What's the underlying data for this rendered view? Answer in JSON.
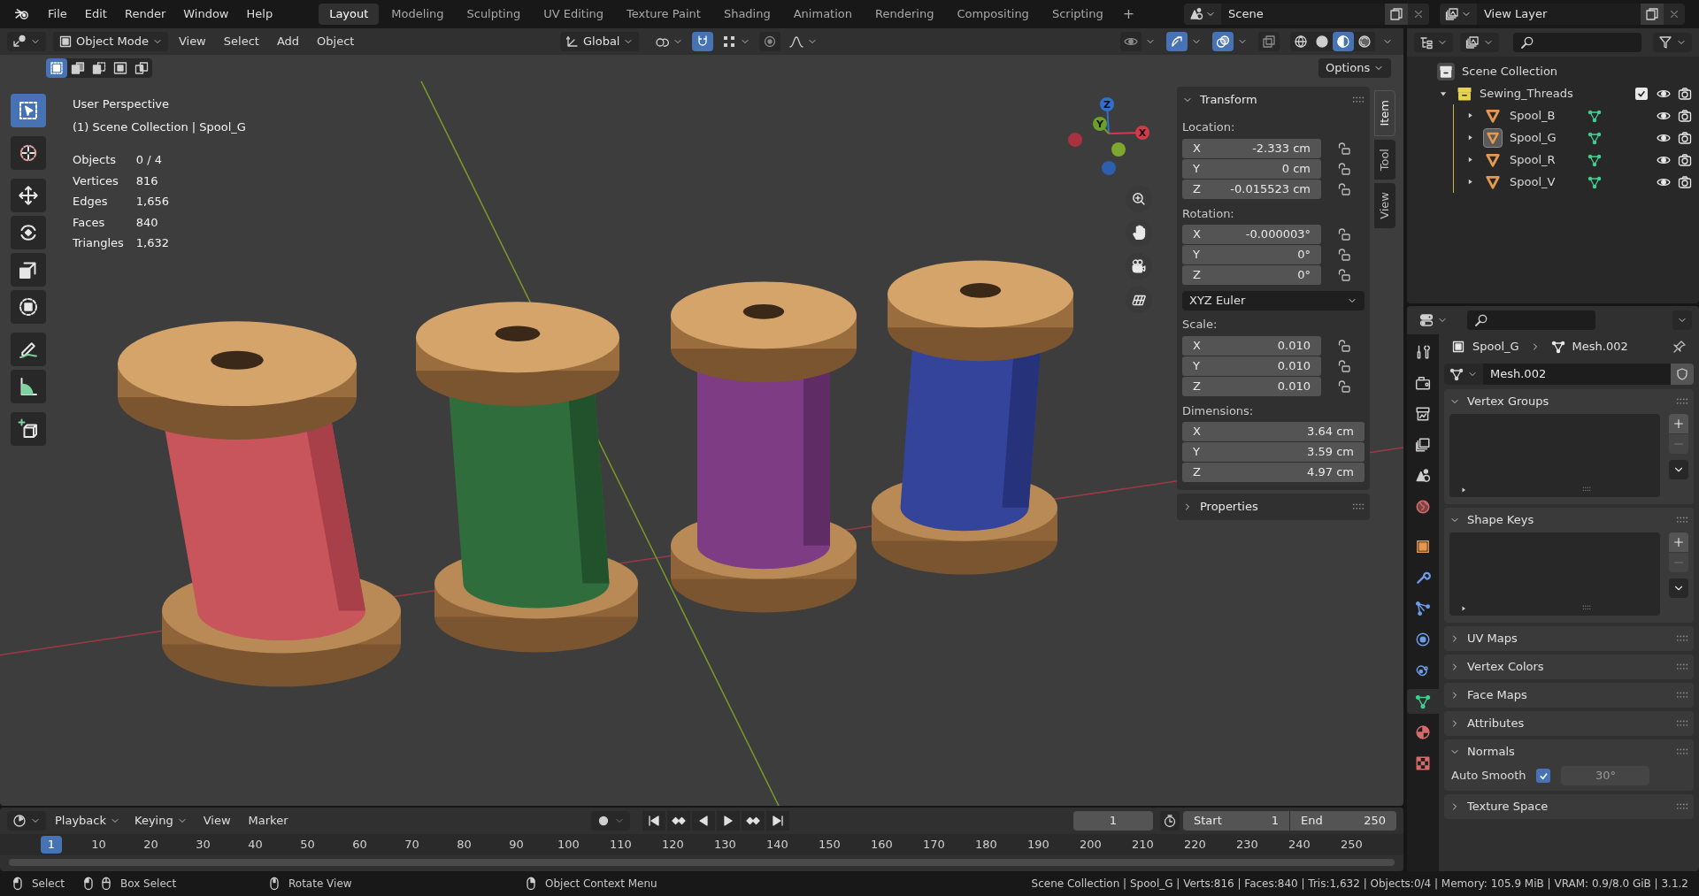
{
  "menu": [
    "File",
    "Edit",
    "Render",
    "Window",
    "Help"
  ],
  "workspaces": [
    {
      "label": "Layout",
      "selected": true
    },
    {
      "label": "Modeling",
      "selected": false
    },
    {
      "label": "Sculpting",
      "selected": false
    },
    {
      "label": "UV Editing",
      "selected": false
    },
    {
      "label": "Texture Paint",
      "selected": false
    },
    {
      "label": "Shading",
      "selected": false
    },
    {
      "label": "Animation",
      "selected": false
    },
    {
      "label": "Rendering",
      "selected": false
    },
    {
      "label": "Compositing",
      "selected": false
    },
    {
      "label": "Scripting",
      "selected": false
    }
  ],
  "add_workspace": "+",
  "scene": "Scene",
  "view_layer": "View Layer",
  "viewport": {
    "mode": "Object Mode",
    "menus": [
      "View",
      "Select",
      "Add",
      "Object"
    ],
    "orientation": "Global",
    "toggles": [
      {
        "kind": "snap",
        "on": true
      },
      {
        "kind": "proportional",
        "on": false
      },
      {
        "kind": "visibility",
        "on": false
      },
      {
        "kind": "gizmos",
        "on": true
      },
      {
        "kind": "overlays",
        "on": true
      },
      {
        "kind": "xray",
        "on": false
      }
    ],
    "shading": [
      {
        "kind": "wireframe",
        "selected": false
      },
      {
        "kind": "solid",
        "selected": false
      },
      {
        "kind": "material",
        "selected": true
      },
      {
        "kind": "rendered",
        "selected": false
      }
    ],
    "select_modes": [
      {
        "selected": true
      },
      {
        "selected": false
      },
      {
        "selected": false
      },
      {
        "selected": false
      },
      {
        "selected": false
      }
    ],
    "options": "Options",
    "tools": [
      {
        "kind": "select",
        "selected": true
      },
      {
        "kind": "cursor",
        "selected": false
      },
      {
        "kind": "move",
        "selected": false
      },
      {
        "kind": "rotate",
        "selected": false
      },
      {
        "kind": "scale",
        "selected": false
      },
      {
        "kind": "transform",
        "selected": false
      },
      {
        "kind": "annotate",
        "selected": false
      },
      {
        "kind": "measure",
        "selected": false
      },
      {
        "kind": "add_cube",
        "selected": false
      }
    ],
    "info": [
      "User Perspective",
      "(1) Scene Collection | Spool_G"
    ],
    "stats": [
      {
        "label": "Objects",
        "value": "0 / 4"
      },
      {
        "label": "Vertices",
        "value": "816"
      },
      {
        "label": "Edges",
        "value": "1,656"
      },
      {
        "label": "Faces",
        "value": "840"
      },
      {
        "label": "Triangles",
        "value": "1,632"
      }
    ],
    "gizmo_axes": [
      "Z",
      "Y",
      "X"
    ],
    "sidebar_tabs": [
      {
        "label": "Item",
        "selected": true
      },
      {
        "label": "Tool",
        "selected": false
      },
      {
        "label": "View",
        "selected": false
      }
    ],
    "transform": {
      "title": "Transform",
      "expanded": true,
      "groups": [
        {
          "kind": "vector",
          "label": "Location:",
          "rows": [
            {
              "axis": "X",
              "value": "-2.333 cm"
            },
            {
              "axis": "Y",
              "value": "0 cm"
            },
            {
              "axis": "Z",
              "value": "-0.015523 cm"
            }
          ]
        },
        {
          "kind": "vector",
          "label": "Rotation:",
          "rows": [
            {
              "axis": "X",
              "value": "-0.000003°"
            },
            {
              "axis": "Y",
              "value": "0°"
            },
            {
              "axis": "Z",
              "value": "0°"
            }
          ]
        },
        {
          "kind": "dropdown",
          "value": "XYZ Euler"
        },
        {
          "kind": "vector",
          "label": "Scale:",
          "rows": [
            {
              "axis": "X",
              "value": "0.010"
            },
            {
              "axis": "Y",
              "value": "0.010"
            },
            {
              "axis": "Z",
              "value": "0.010"
            }
          ]
        },
        {
          "kind": "wide_vector",
          "label": "Dimensions:",
          "rows": [
            {
              "axis": "X",
              "value": "3.64 cm"
            },
            {
              "axis": "Y",
              "value": "3.59 cm"
            },
            {
              "axis": "Z",
              "value": "4.97 cm"
            }
          ]
        }
      ]
    },
    "properties_panel": {
      "title": "Properties",
      "expanded": false
    }
  },
  "outliner": {
    "root": "Scene Collection",
    "children": [
      {
        "name": "Sewing_Threads",
        "kind": "collection",
        "expanded": true,
        "checked": true,
        "children": [
          {
            "name": "Spool_B",
            "kind": "mesh",
            "expanded": false,
            "active": false
          },
          {
            "name": "Spool_G",
            "kind": "mesh",
            "expanded": false,
            "active": true
          },
          {
            "name": "Spool_R",
            "kind": "mesh",
            "expanded": false,
            "active": false
          },
          {
            "name": "Spool_V",
            "kind": "mesh",
            "expanded": false,
            "active": false
          }
        ]
      }
    ]
  },
  "properties": {
    "tabs": [
      {
        "kind": "tool",
        "selected": false
      },
      {
        "kind": "render",
        "selected": false
      },
      {
        "kind": "output",
        "selected": false
      },
      {
        "kind": "view_layer",
        "selected": false
      },
      {
        "kind": "scene",
        "selected": false
      },
      {
        "kind": "world",
        "selected": false
      },
      {
        "kind": "object",
        "selected": false
      },
      {
        "kind": "modifiers",
        "selected": false
      },
      {
        "kind": "particles",
        "selected": false
      },
      {
        "kind": "physics",
        "selected": false
      },
      {
        "kind": "constraints",
        "selected": false
      },
      {
        "kind": "data",
        "selected": true
      },
      {
        "kind": "material",
        "selected": false
      },
      {
        "kind": "texture",
        "selected": false
      }
    ],
    "breadcrumb": [
      "Spool_G",
      "Mesh.002"
    ],
    "mesh_name": "Mesh.002",
    "panels": [
      {
        "title": "Vertex Groups",
        "kind": "list",
        "expanded": true
      },
      {
        "title": "Shape Keys",
        "kind": "list",
        "expanded": true
      },
      {
        "title": "UV Maps",
        "expanded": false
      },
      {
        "title": "Vertex Colors",
        "expanded": false
      },
      {
        "title": "Face Maps",
        "expanded": false
      },
      {
        "title": "Attributes",
        "expanded": false
      },
      {
        "title": "Normals",
        "kind": "normals",
        "expanded": true,
        "auto_smooth": {
          "label": "Auto Smooth",
          "checked": true,
          "angle": "30°"
        }
      },
      {
        "title": "Texture Space",
        "expanded": false
      }
    ]
  },
  "timeline": {
    "menus": [
      "Playback",
      "Keying",
      "View",
      "Marker"
    ],
    "current_frame": "1",
    "start_label": "Start",
    "start": "1",
    "end_label": "End",
    "end": "250",
    "playhead": "1",
    "ruler": [
      "10",
      "20",
      "30",
      "40",
      "50",
      "60",
      "70",
      "80",
      "90",
      "100",
      "110",
      "120",
      "130",
      "140",
      "150",
      "160",
      "170",
      "180",
      "190",
      "200",
      "210",
      "220",
      "230",
      "240",
      "250"
    ]
  },
  "status": {
    "hints": [
      {
        "kind": "left_mouse",
        "text": "Select"
      },
      {
        "kind": "drag",
        "text": "Box Select"
      },
      {
        "kind": "middle_mouse",
        "text": "Rotate View"
      },
      {
        "kind": "right_mouse",
        "text": "Object Context Menu"
      }
    ],
    "info": "Scene Collection | Spool_G | Verts:816 | Faces:840 | Tris:1,632 | Objects:0/4 | Memory: 105.9 MiB | VRAM: 0.9/8.0 GiB | 3.1.2"
  }
}
